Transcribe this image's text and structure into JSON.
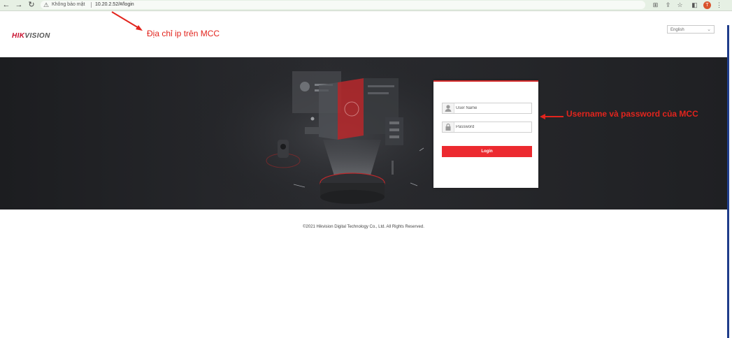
{
  "browser": {
    "security_label": "Không bảo mật",
    "url": "10.20.2.52/#/login",
    "profile_initial": "T"
  },
  "header": {
    "logo_part1": "HIK",
    "logo_part2": "VISION",
    "language": "English"
  },
  "login": {
    "username_placeholder": "User Name",
    "password_placeholder": "Password",
    "button_label": "Login"
  },
  "footer": {
    "copyright": "©2021 Hikvision Digital Technology Co., Ltd. All Rights Reserved."
  },
  "annotations": {
    "ip_note": "Địa chỉ ip trên MCC",
    "credentials_note": "Username và password của MCC"
  },
  "colors": {
    "accent_red": "#ec2a30",
    "annotation_red": "#e2241d",
    "banner_dark": "#1c1d20",
    "toolbar_bg": "#e6f0e4"
  }
}
